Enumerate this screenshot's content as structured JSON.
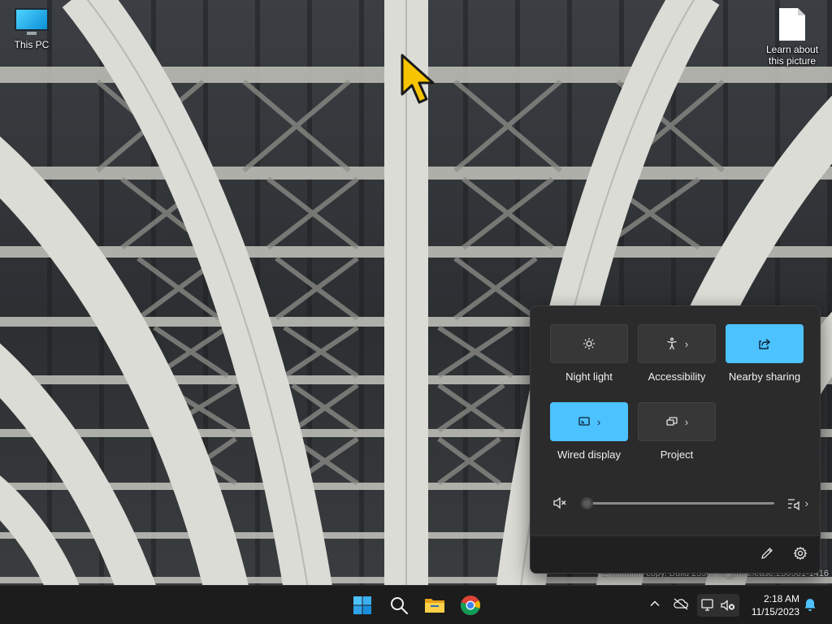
{
  "desktop": {
    "icons": [
      {
        "label": "This PC",
        "icon": "monitor-icon"
      },
      {
        "label": "Learn about this picture",
        "icon": "document-icon"
      }
    ],
    "watermark": "Evaluation copy. Build 25947.rs_prerelease.230901-1416"
  },
  "quick_settings": {
    "tiles": [
      {
        "label": "Night light",
        "icon": "brightness-icon",
        "on": false,
        "has_chevron": false
      },
      {
        "label": "Accessibility",
        "icon": "accessibility-icon",
        "on": false,
        "has_chevron": true
      },
      {
        "label": "Nearby sharing",
        "icon": "share-icon",
        "on": true,
        "has_chevron": false
      },
      {
        "label": "Wired display",
        "icon": "cast-icon",
        "on": true,
        "has_chevron": true
      },
      {
        "label": "Project",
        "icon": "project-icon",
        "on": false,
        "has_chevron": true
      }
    ],
    "volume": {
      "level": 0,
      "muted": true
    },
    "footer": {
      "edit_icon": "pencil-icon",
      "settings_icon": "gear-icon"
    },
    "accent_color": "#4cc2ff"
  },
  "taskbar": {
    "apps": [
      "start-icon",
      "search-icon",
      "file-explorer-icon",
      "chrome-icon"
    ],
    "tray": [
      "chevron-up-icon",
      "cloud-off-icon",
      "network-icon",
      "volume-muted-icon"
    ],
    "clock": {
      "time": "2:18 AM",
      "date": "11/15/2023"
    },
    "notifications_icon": "bell-icon"
  }
}
